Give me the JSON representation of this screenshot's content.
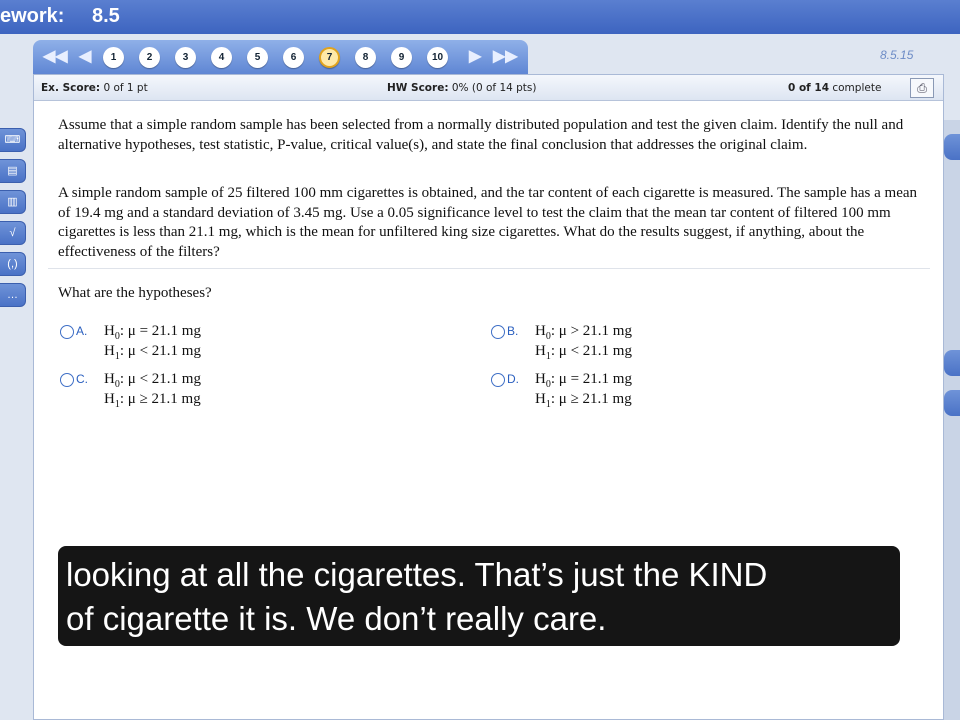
{
  "header": {
    "label": "ework:",
    "section": "8.5"
  },
  "nav": {
    "first_arrow": "◀◀",
    "prev_arrow": "◀",
    "next_arrow": "▶",
    "last_arrow": "▶▶",
    "questions": [
      "1",
      "2",
      "3",
      "4",
      "5",
      "6",
      "7",
      "8",
      "9",
      "10"
    ],
    "current": "7"
  },
  "question_id": "8.5.15",
  "scores": {
    "ex_label": "Ex. Score:",
    "ex_value": "0 of 1 pt",
    "hw_label": "HW Score:",
    "hw_value": "0% (0 of 14 pts)",
    "complete_count": "0 of 14",
    "complete_label": "complete"
  },
  "question": {
    "instructions": "Assume that a simple random sample has been selected from a normally distributed population and test the given claim. Identify the null and alternative hypotheses, test statistic, P-value, critical value(s), and state the final conclusion that addresses the original claim.",
    "body": "A simple random sample of 25 filtered 100 mm cigarettes is obtained, and the tar content of each cigarette is measured. The sample has a mean of 19.4 mg and a standard deviation of 3.45 mg. Use a 0.05 significance level to test the claim that the mean tar content of filtered 100 mm cigarettes is less than 21.1 mg, which is the mean for unfiltered king size cigarettes. What do the results suggest, if anything, about the effectiveness of the filters?",
    "prompt": "What are the hypotheses?"
  },
  "options": [
    {
      "letter": "A.",
      "h0_rel": "=",
      "h1_rel": "<",
      "value": "21.1 mg"
    },
    {
      "letter": "B.",
      "h0_rel": ">",
      "h1_rel": "<",
      "value": "21.1 mg"
    },
    {
      "letter": "C.",
      "h0_rel": "<",
      "h1_rel": "≥",
      "value": "21.1 mg"
    },
    {
      "letter": "D.",
      "h0_rel": "=",
      "h1_rel": "≥",
      "value": "21.1 mg"
    }
  ],
  "caption": {
    "line1": "looking at all the cigarettes. That’s just the KIND",
    "line2": "of cigarette it is. We don’t really care."
  },
  "colors": {
    "accent": "#3d64c0",
    "nav_bg": "#6f93d8",
    "current_ring": "#e0a31f"
  }
}
